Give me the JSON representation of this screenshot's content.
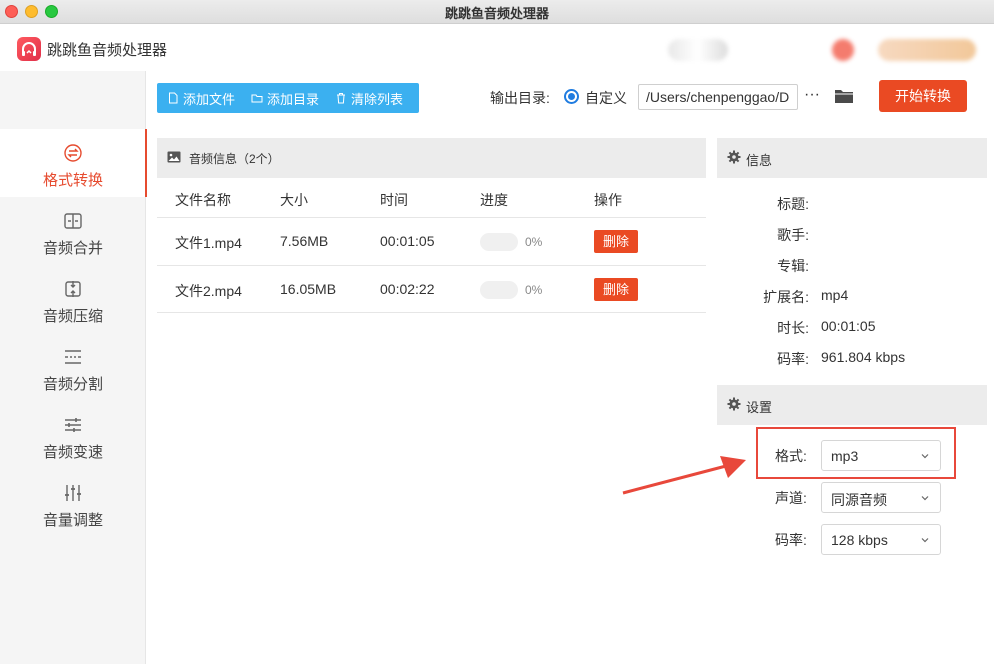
{
  "window": {
    "title": "跳跳鱼音频处理器"
  },
  "app": {
    "name": "跳跳鱼音频处理器"
  },
  "sidebar": {
    "items": [
      {
        "label": "格式转换",
        "icon": "convert-icon",
        "active": true
      },
      {
        "label": "音频合并",
        "icon": "merge-icon",
        "active": false
      },
      {
        "label": "音频压缩",
        "icon": "compress-icon",
        "active": false
      },
      {
        "label": "音频分割",
        "icon": "split-icon",
        "active": false
      },
      {
        "label": "音频变速",
        "icon": "speed-icon",
        "active": false
      },
      {
        "label": "音量调整",
        "icon": "volume-icon",
        "active": false
      }
    ]
  },
  "toolbar": {
    "add_file": "添加文件",
    "add_dir": "添加目录",
    "clear_list": "清除列表",
    "output_label": "输出目录:",
    "custom_option": "自定义",
    "output_path": "/Users/chenpenggao/D",
    "more": "···",
    "start": "开始转换"
  },
  "audio_panel": {
    "title": "音频信息（2个）",
    "columns": [
      "文件名称",
      "大小",
      "时间",
      "进度",
      "操作"
    ],
    "rows": [
      {
        "name": "文件1.mp4",
        "size": "7.56MB",
        "time": "00:01:05",
        "progress": "0%",
        "action": "删除"
      },
      {
        "name": "文件2.mp4",
        "size": "16.05MB",
        "time": "00:02:22",
        "progress": "0%",
        "action": "删除"
      }
    ]
  },
  "info_panel": {
    "title": "信息",
    "fields": [
      {
        "label": "标题:",
        "value": ""
      },
      {
        "label": "歌手:",
        "value": ""
      },
      {
        "label": "专辑:",
        "value": ""
      },
      {
        "label": "扩展名:",
        "value": "mp4"
      },
      {
        "label": "时长:",
        "value": "00:01:05"
      },
      {
        "label": "码率:",
        "value": "961.804 kbps"
      }
    ]
  },
  "settings_panel": {
    "title": "设置",
    "format": {
      "label": "格式:",
      "value": "mp3"
    },
    "channel": {
      "label": "声道:",
      "value": "同源音频"
    },
    "bitrate": {
      "label": "码率:",
      "value": "128 kbps"
    }
  },
  "colors": {
    "accent": "#e64b2f",
    "toolbar_blue": "#3bb0f0",
    "start_button": "#ea4a23",
    "annotation": "#e8483b"
  }
}
